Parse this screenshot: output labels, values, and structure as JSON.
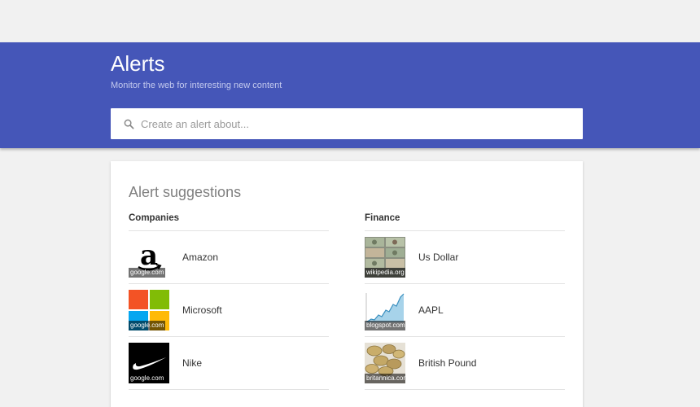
{
  "header": {
    "title": "Alerts",
    "subtitle": "Monitor the web for interesting new content",
    "search_placeholder": "Create an alert about...",
    "accent_color": "#4556b8"
  },
  "suggestions": {
    "title": "Alert suggestions",
    "companies": {
      "heading": "Companies",
      "items": [
        {
          "label": "Amazon",
          "source": "google.com",
          "icon": "amazon-logo"
        },
        {
          "label": "Microsoft",
          "source": "google.com",
          "icon": "microsoft-logo"
        },
        {
          "label": "Nike",
          "source": "google.com",
          "icon": "nike-logo"
        }
      ]
    },
    "finance": {
      "heading": "Finance",
      "items": [
        {
          "label": "Us Dollar",
          "source": "wikipedia.org",
          "icon": "dollar-bills-image"
        },
        {
          "label": "AAPL",
          "source": "blogspot.com",
          "icon": "stock-chart-image"
        },
        {
          "label": "British Pound",
          "source": "britannica.com",
          "icon": "pound-coins-image"
        }
      ]
    }
  }
}
